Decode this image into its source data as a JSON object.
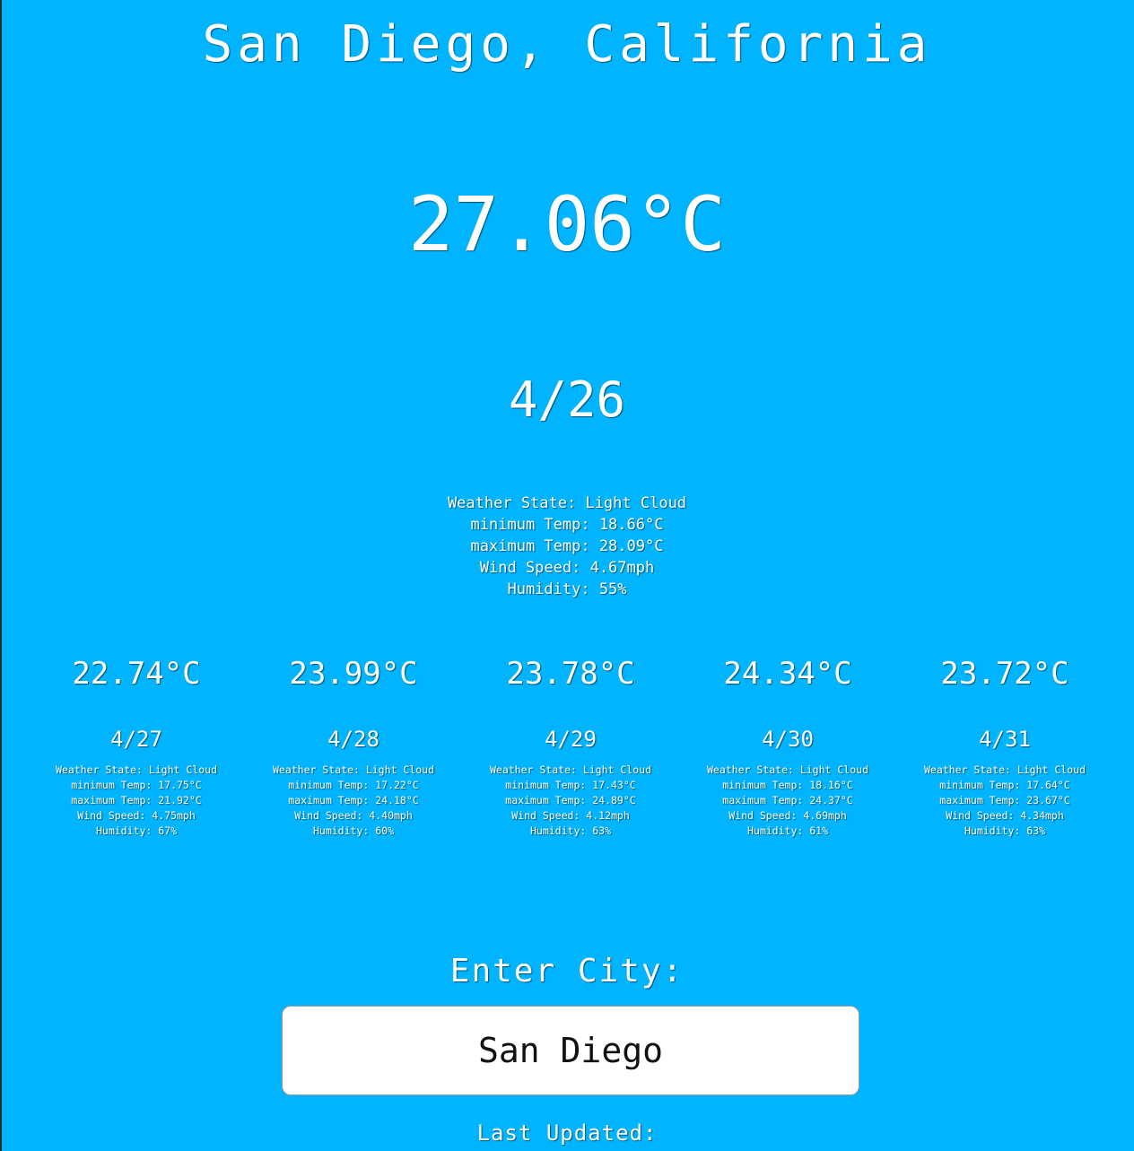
{
  "header": {
    "city_title": "San Diego, California"
  },
  "current": {
    "temperature": "27.06°C",
    "date": "4/26",
    "details": [
      "Weather State: Light Cloud",
      "minimum Temp: 18.66°C",
      "maximum Temp: 28.09°C",
      "Wind Speed: 4.67mph",
      "Humidity: 55%"
    ]
  },
  "forecast": [
    {
      "temperature": "22.74°C",
      "date": "4/27",
      "details": [
        "Weather State: Light Cloud",
        "minimum Temp: 17.75°C",
        "maximum Temp: 21.92°C",
        "Wind Speed: 4.75mph",
        "Humidity: 67%"
      ]
    },
    {
      "temperature": "23.99°C",
      "date": "4/28",
      "details": [
        "Weather State: Light Cloud",
        "minimum Temp: 17.22°C",
        "maximum Temp: 24.18°C",
        "Wind Speed: 4.40mph",
        "Humidity: 60%"
      ]
    },
    {
      "temperature": "23.78°C",
      "date": "4/29",
      "details": [
        "Weather State: Light Cloud",
        "minimum Temp: 17.43°C",
        "maximum Temp: 24.89°C",
        "Wind Speed: 4.12mph",
        "Humidity: 63%"
      ]
    },
    {
      "temperature": "24.34°C",
      "date": "4/30",
      "details": [
        "Weather State: Light Cloud",
        "minimum Temp: 18.16°C",
        "maximum Temp: 24.37°C",
        "Wind Speed: 4.69mph",
        "Humidity: 61%"
      ]
    },
    {
      "temperature": "23.72°C",
      "date": "4/31",
      "details": [
        "Weather State: Light Cloud",
        "minimum Temp: 17.64°C",
        "maximum Temp: 23.67°C",
        "Wind Speed: 4.34mph",
        "Humidity: 63%"
      ]
    }
  ],
  "search": {
    "label": "Enter City:",
    "value": "San Diego"
  },
  "footer": {
    "last_updated_label": "Last Updated:"
  },
  "colors": {
    "background": "#00b4ff",
    "text": "#ffffff",
    "input_background": "#ffffff"
  }
}
